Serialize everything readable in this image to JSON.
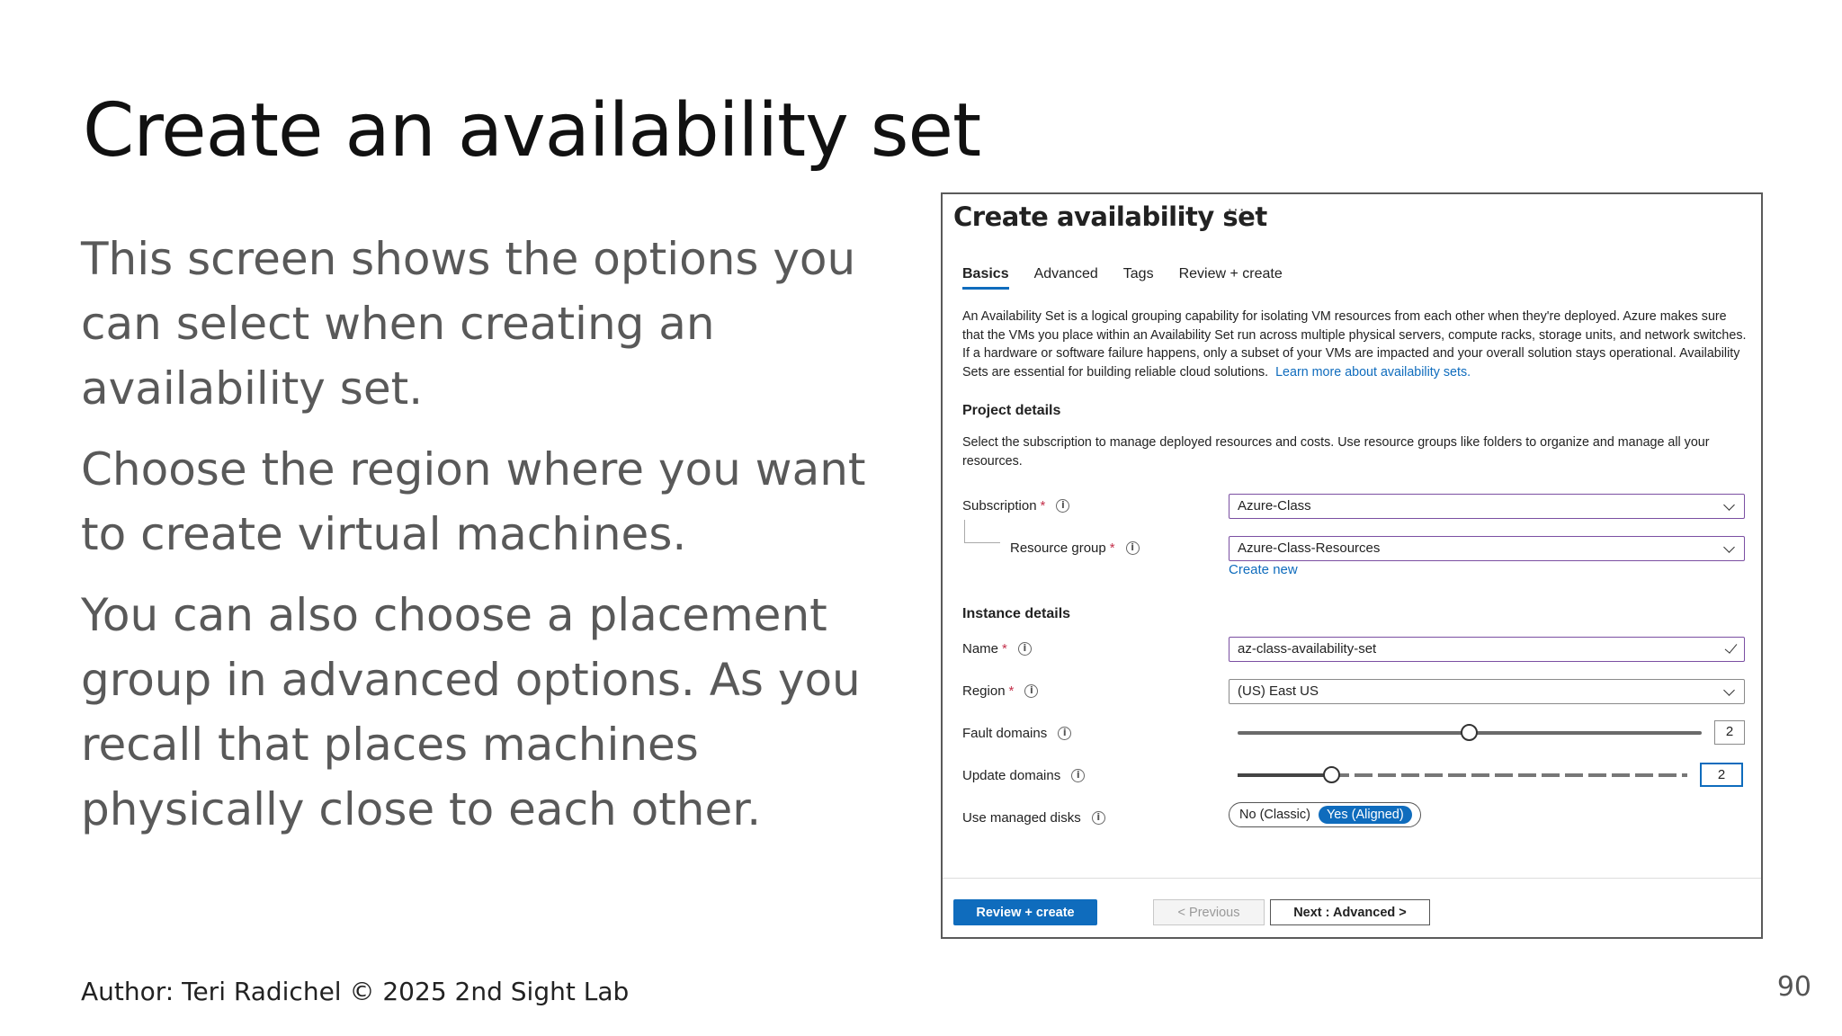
{
  "slide": {
    "title": "Create an availability set",
    "paragraphs": [
      "This screen shows the options you can select when creating an availability set.",
      "Choose the region where you want to create virtual machines.",
      "You can also choose a placement group in advanced options. As you recall that places machines physically close to each other."
    ],
    "author": "Author: Teri Radichel © 2025 2nd Sight Lab",
    "page_number": "90"
  },
  "panel": {
    "title": "Create availability set",
    "ellipsis": "···",
    "tabs": [
      {
        "label": "Basics",
        "active": true
      },
      {
        "label": "Advanced",
        "active": false
      },
      {
        "label": "Tags",
        "active": false
      },
      {
        "label": "Review + create",
        "active": false
      }
    ],
    "description": "An Availability Set is a logical grouping capability for isolating VM resources from each other when they're deployed. Azure makes sure that the VMs you place within an Availability Set run across multiple physical servers, compute racks, storage units, and network switches. If a hardware or software failure happens, only a subset of your VMs are impacted and your overall solution stays operational. Availability Sets are essential for building reliable cloud solutions.",
    "learn_more": "Learn more about availability sets.",
    "project_details": {
      "heading": "Project details",
      "description": "Select the subscription to manage deployed resources and costs. Use resource groups like folders to organize and manage all your resources."
    },
    "subscription": {
      "label": "Subscription",
      "required": "*",
      "value": "Azure-Class"
    },
    "resource_group": {
      "label": "Resource group",
      "required": "*",
      "value": "Azure-Class-Resources",
      "create_new": "Create new"
    },
    "instance_details": {
      "heading": "Instance details"
    },
    "name": {
      "label": "Name",
      "required": "*",
      "value": "az-class-availability-set"
    },
    "region": {
      "label": "Region",
      "required": "*",
      "value": "(US) East US"
    },
    "fault_domains": {
      "label": "Fault domains",
      "value": "2",
      "level": 0.5
    },
    "update_domains": {
      "label": "Update domains",
      "value": "2",
      "level": 0.21
    },
    "managed_disks": {
      "label": "Use managed disks",
      "options": [
        {
          "label": "No (Classic)",
          "selected": false
        },
        {
          "label": "Yes (Aligned)",
          "selected": true
        }
      ]
    },
    "buttons": {
      "review_create": "Review + create",
      "previous": "< Previous",
      "next": "Next : Advanced >"
    },
    "info_glyph": "i"
  }
}
